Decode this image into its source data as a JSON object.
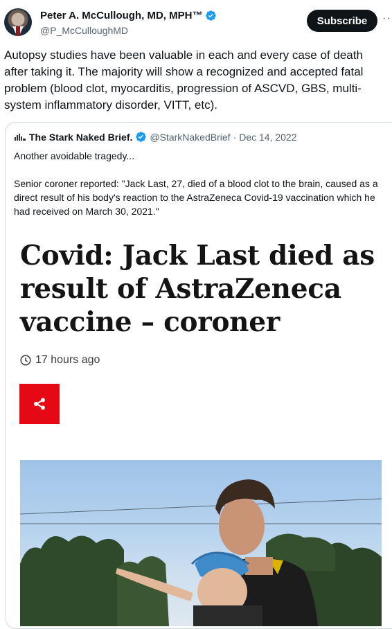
{
  "author": {
    "name": "Peter A. McCullough, MD, MPH™",
    "handle": "@P_McCulloughMD",
    "verified_color": "#1d9bf0"
  },
  "actions": {
    "subscribe_label": "Subscribe",
    "more_label": "··"
  },
  "tweet": {
    "text": "Autopsy studies have been valuable in each and every case of death after taking it.  The majority will show a recognized and accepted fatal problem (blood clot, myocarditis, progression of ASCVD, GBS, multi-system inflammatory disorder, VITT, etc)."
  },
  "quote": {
    "source_name": "The Stark Naked Brief.",
    "handle": "@StarkNakedBrief",
    "separator": "·",
    "date": "Dec 14, 2022",
    "line1": "Another avoidable tragedy...",
    "line2": "Senior coroner reported: \"Jack Last, 27, died of a blood clot to the brain, caused as a direct result of his body's reaction to the AstraZeneca Covid-19 vaccination which he had received on March 30, 2021.\"",
    "article": {
      "headline": "Covid: Jack Last died as result of AstraZeneca vaccine – coroner",
      "timestamp": "17 hours ago",
      "share_color": "#e50914"
    }
  },
  "icons": {
    "verified": "verified-badge-icon",
    "clock": "clock-icon",
    "share": "share-icon",
    "logo": "stark-naked-logo-icon"
  }
}
